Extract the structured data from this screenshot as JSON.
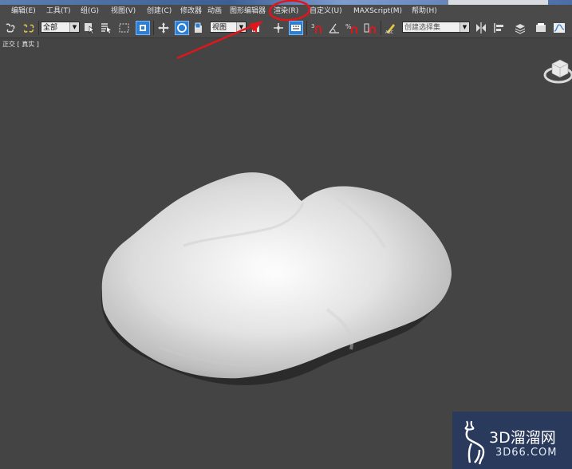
{
  "menubar": {
    "items": [
      {
        "label": "编辑(E)"
      },
      {
        "label": "工具(T)"
      },
      {
        "label": "组(G)"
      },
      {
        "label": "视图(V)"
      },
      {
        "label": "创建(C)"
      },
      {
        "label": "修改器"
      },
      {
        "label": "动画"
      },
      {
        "label": "图形编辑器"
      },
      {
        "label": "渲染(R)"
      },
      {
        "label": "自定义(U)"
      },
      {
        "label": "MAXScript(M)"
      },
      {
        "label": "帮助(H)"
      }
    ]
  },
  "toolbar": {
    "selection_filter": "全部",
    "reference_coord": "视图",
    "snap_label": "3",
    "named_selection_placeholder": "创建选择集"
  },
  "viewport": {
    "label": "正交 [ 真实 ]"
  },
  "watermark": {
    "line1": "3D溜溜网",
    "line2": "3D66.COM"
  },
  "colors": {
    "background": "#444444",
    "menu_bg": "#4a4a4a",
    "active_button": "#2c7fd6",
    "annotation": "#e0161d",
    "watermark_bg": "#283a60"
  }
}
